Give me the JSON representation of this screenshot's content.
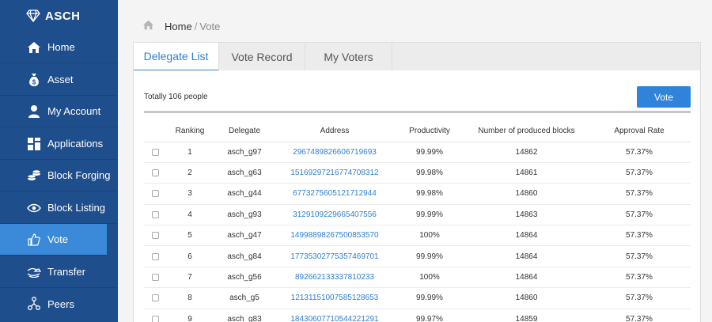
{
  "app": {
    "name": "ASCH"
  },
  "sidebar": {
    "items": [
      {
        "label": "Home",
        "icon": "home-icon"
      },
      {
        "label": "Asset",
        "icon": "money-bag-icon"
      },
      {
        "label": "My Account",
        "icon": "user-icon"
      },
      {
        "label": "Applications",
        "icon": "grid-icon"
      },
      {
        "label": "Block Forging",
        "icon": "coins-icon"
      },
      {
        "label": "Block Listing",
        "icon": "eye-icon"
      },
      {
        "label": "Vote",
        "icon": "thumbs-up-icon",
        "active": true
      },
      {
        "label": "Transfer",
        "icon": "transfer-icon"
      },
      {
        "label": "Peers",
        "icon": "network-icon"
      }
    ]
  },
  "breadcrumb": {
    "home": "Home",
    "separator": "/",
    "current": "Vote"
  },
  "tabs": [
    {
      "label": "Delegate List",
      "active": true
    },
    {
      "label": "Vote Record"
    },
    {
      "label": "My Voters"
    }
  ],
  "summary": {
    "total_text": "Totally 106 people"
  },
  "toolbar": {
    "vote_label": "Vote"
  },
  "table": {
    "headers": [
      "Ranking",
      "Delegate",
      "Address",
      "Productivity",
      "Number of produced blocks",
      "Approval Rate"
    ],
    "rows": [
      {
        "ranking": "1",
        "delegate": "asch_g97",
        "address": "2967489826606719693",
        "productivity": "99.99%",
        "blocks": "14862",
        "approval": "57.37%"
      },
      {
        "ranking": "2",
        "delegate": "asch_g63",
        "address": "15169297216774708312",
        "productivity": "99.98%",
        "blocks": "14861",
        "approval": "57.37%"
      },
      {
        "ranking": "3",
        "delegate": "asch_g44",
        "address": "6773275605121712944",
        "productivity": "99.98%",
        "blocks": "14860",
        "approval": "57.37%"
      },
      {
        "ranking": "4",
        "delegate": "asch_g93",
        "address": "3129109229665407556",
        "productivity": "99.99%",
        "blocks": "14863",
        "approval": "57.37%"
      },
      {
        "ranking": "5",
        "delegate": "asch_g47",
        "address": "14998898267500853570",
        "productivity": "100%",
        "blocks": "14864",
        "approval": "57.37%"
      },
      {
        "ranking": "6",
        "delegate": "asch_g84",
        "address": "17735302775357469701",
        "productivity": "99.99%",
        "blocks": "14864",
        "approval": "57.37%"
      },
      {
        "ranking": "7",
        "delegate": "asch_g56",
        "address": "892662133337810233",
        "productivity": "100%",
        "blocks": "14864",
        "approval": "57.37%"
      },
      {
        "ranking": "8",
        "delegate": "asch_g5",
        "address": "12131151007585128653",
        "productivity": "99.99%",
        "blocks": "14860",
        "approval": "57.37%"
      },
      {
        "ranking": "9",
        "delegate": "asch_g83",
        "address": "18430607710544221291",
        "productivity": "99.97%",
        "blocks": "14859",
        "approval": "57.37%"
      }
    ]
  },
  "colors": {
    "sidebar": "#1f4e8c",
    "active": "#3a8ad9",
    "accent": "#2f7fd0"
  }
}
